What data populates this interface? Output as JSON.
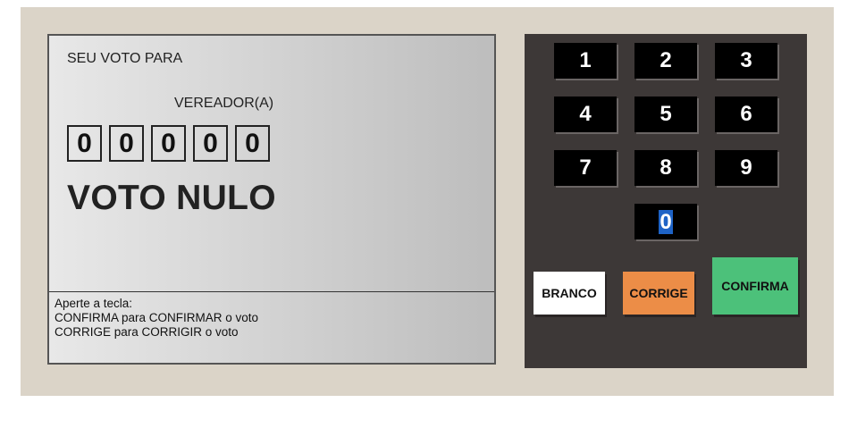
{
  "screen": {
    "heading": "SEU VOTO PARA",
    "office": "VEREADOR(A)",
    "digits": [
      "0",
      "0",
      "0",
      "0",
      "0"
    ],
    "status": "VOTO NULO",
    "instructions": [
      "Aperte a tecla:",
      "CONFIRMA para CONFIRMAR o voto",
      "CORRIGE para CORRIGIR o voto"
    ]
  },
  "keypad": {
    "keys": [
      "1",
      "2",
      "3",
      "4",
      "5",
      "6",
      "7",
      "8",
      "9",
      "0"
    ],
    "branco": "BRANCO",
    "corrige": "CORRIGE",
    "confirma": "CONFIRMA"
  },
  "colors": {
    "branco": "#ffffff",
    "corrige": "#ec8d47",
    "confirma": "#4cc17a",
    "keypad_bg": "#3d3837",
    "machine_bg": "#dbd4c8"
  }
}
